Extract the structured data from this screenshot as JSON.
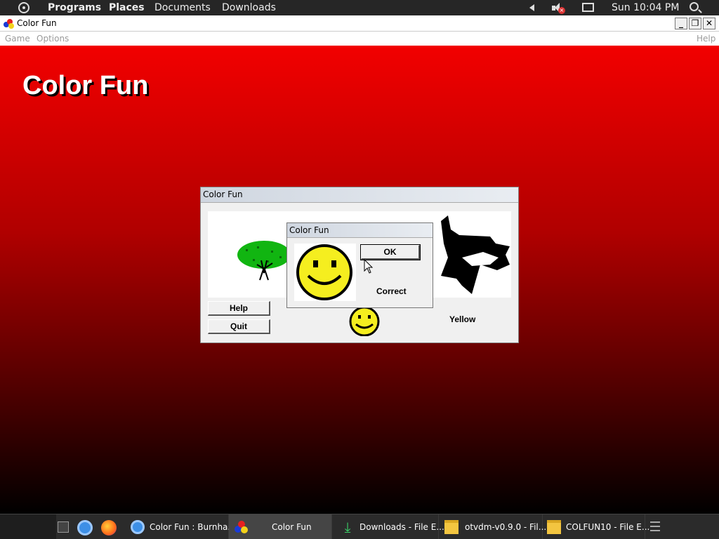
{
  "top_panel": {
    "programs": "Programs",
    "places": "Places",
    "documents": "Documents",
    "downloads": "Downloads",
    "clock": "Sun 10:04 PM"
  },
  "window": {
    "title": "Color Fun",
    "menu": {
      "game": "Game",
      "options": "Options",
      "help": "Help"
    },
    "controls": {
      "minimize": "_",
      "restore": "❐",
      "close": "✕"
    }
  },
  "game": {
    "heading": "Color Fun",
    "dialog": {
      "title": "Color Fun",
      "help_button": "Help",
      "quit_button": "Quit",
      "color_word": "Yellow"
    },
    "message_box": {
      "title": "Color Fun",
      "ok_button": "OK",
      "result": "Correct"
    }
  },
  "taskbar": {
    "tasks": [
      {
        "label": "Color Fun : Burnha...",
        "icon": "chrome-icon"
      },
      {
        "label": "Color Fun",
        "icon": "color-fun-icon",
        "active": true
      },
      {
        "label": "Downloads - File E...",
        "icon": "download-icon"
      },
      {
        "label": "otvdm-v0.9.0 - Fil...",
        "icon": "folder-icon"
      },
      {
        "label": "COLFUN10 - File E...",
        "icon": "folder-icon"
      }
    ]
  },
  "colors": {
    "background_top": "#f20000",
    "background_bottom": "#000000",
    "smiley_yellow": "#f5ee1f",
    "tree_green": "#11b511"
  }
}
